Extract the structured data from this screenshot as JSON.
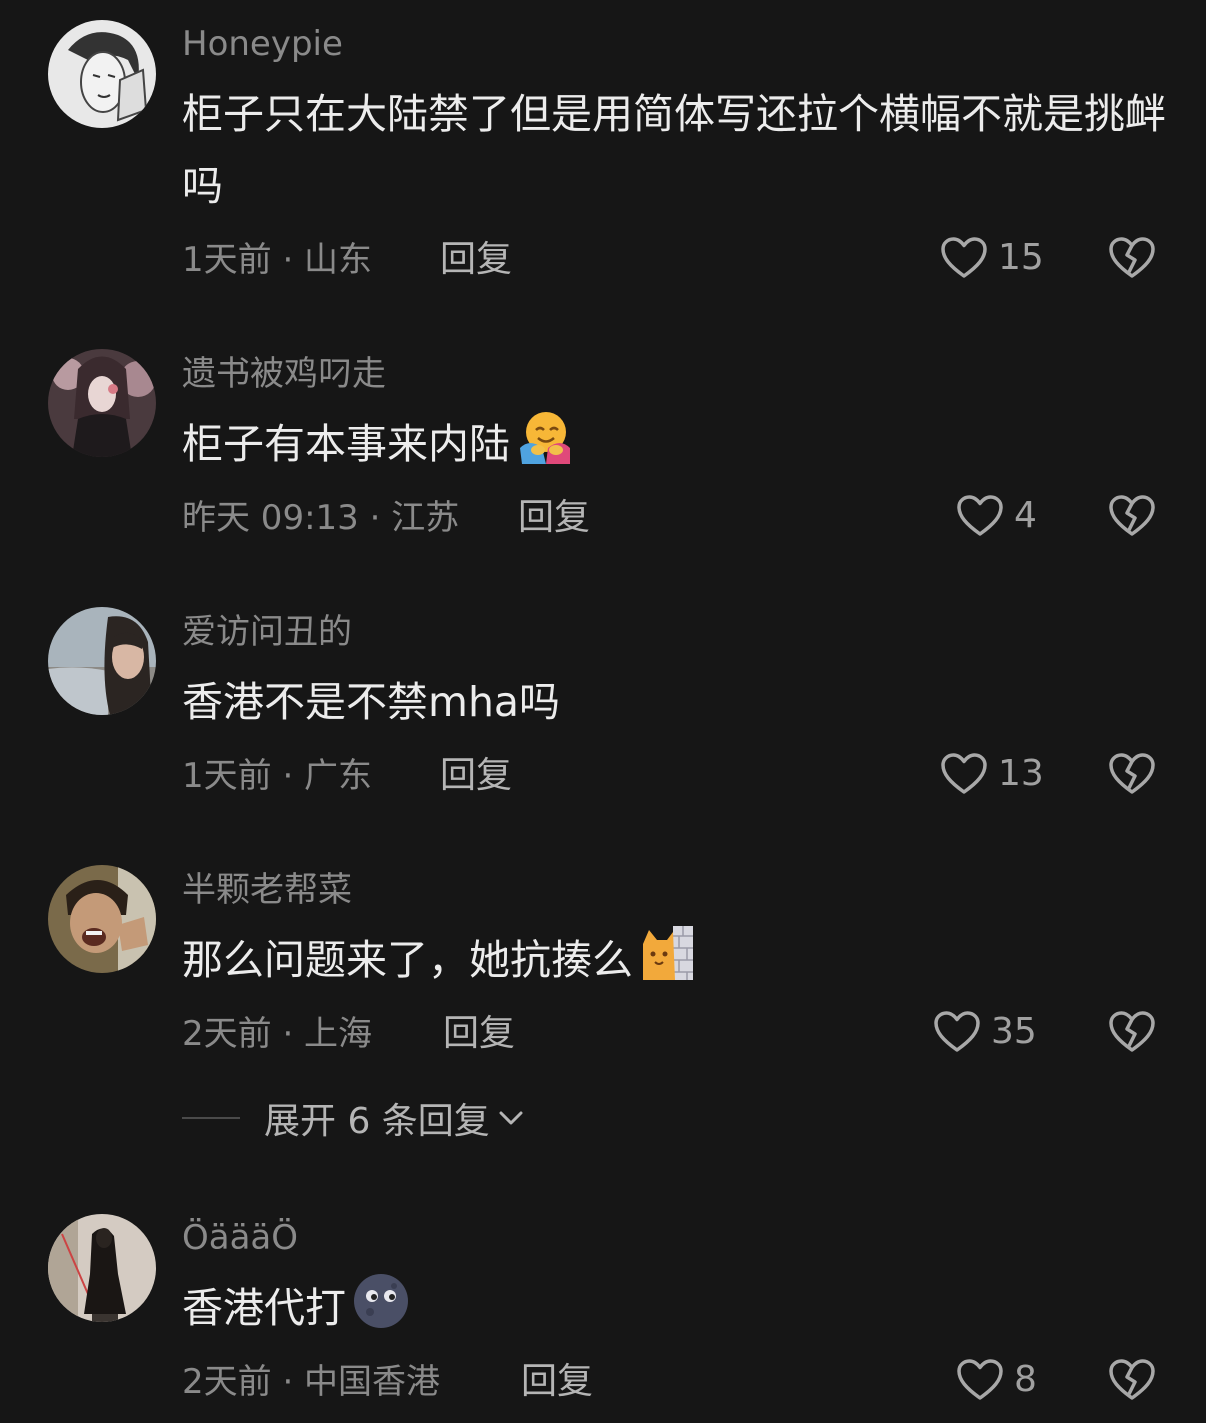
{
  "comments": [
    {
      "username": "Honeypie",
      "text": "柜子只在大陆禁了但是用简体写还拉个横幅不就是挑衅吗",
      "time": "1天前 · 山东",
      "reply": "回复",
      "likes": "15",
      "avatar": "sketch-man-avatar"
    },
    {
      "username": "遗书被鸡叼走",
      "text": "柜子有本事来内陆",
      "emoji": "hugging-face-emoji",
      "time": "昨天 09:13 · 江苏",
      "reply": "回复",
      "likes": "4",
      "avatar": "anime-girl-avatar"
    },
    {
      "username": "爱访问丑的",
      "text": "香港不是不禁mha吗",
      "time": "1天前 · 广东",
      "reply": "回复",
      "likes": "13",
      "avatar": "woman-seaside-avatar"
    },
    {
      "username": "半颗老帮菜",
      "text": "那么问题来了，她抗揍么",
      "emoji": "cat-wall-emoji",
      "time": "2天前 · 上海",
      "reply": "回复",
      "likes": "35",
      "avatar": "shouting-man-avatar"
    },
    {
      "username": "ÖäääÖ",
      "text": "香港代打",
      "emoji": "new-moon-face-emoji",
      "time": "2天前 · 中国香港",
      "reply": "回复",
      "likes": "8",
      "avatar": "dark-figure-avatar"
    }
  ],
  "expand_replies": "展开 6 条回复",
  "icons": {
    "like": "heart-outline-icon",
    "dislike": "broken-heart-icon",
    "expand": "chevron-down-icon"
  },
  "colors": {
    "background": "#161616",
    "text": "#ececec",
    "muted": "#8a8a8a"
  }
}
